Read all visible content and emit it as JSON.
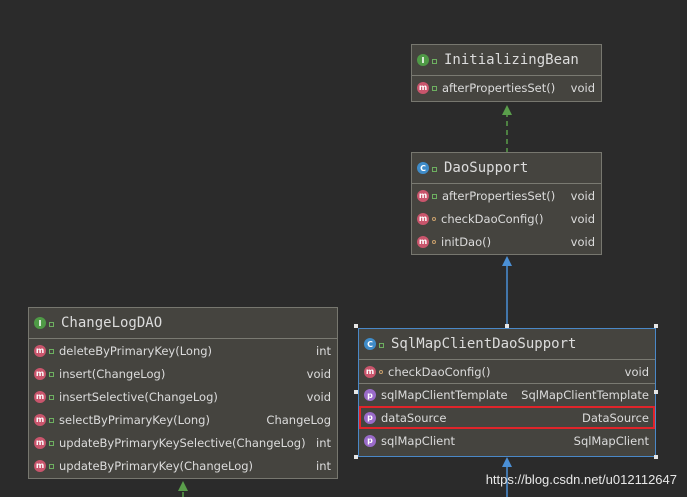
{
  "classes": {
    "initializing_bean": {
      "title": "InitializingBean",
      "kind_icon": "I",
      "rows": [
        {
          "icon": "m",
          "name": "afterPropertiesSet()",
          "type": "void"
        }
      ]
    },
    "dao_support": {
      "title": "DaoSupport",
      "kind_icon": "C",
      "rows": [
        {
          "icon": "m",
          "name": "afterPropertiesSet()",
          "type": "void"
        },
        {
          "icon": "m",
          "name": "checkDaoConfig()",
          "type": "void"
        },
        {
          "icon": "m",
          "name": "initDao()",
          "type": "void"
        }
      ]
    },
    "change_log_dao": {
      "title": "ChangeLogDAO",
      "kind_icon": "I",
      "rows": [
        {
          "icon": "m",
          "name": "deleteByPrimaryKey(Long)",
          "type": "int"
        },
        {
          "icon": "m",
          "name": "insert(ChangeLog)",
          "type": "void"
        },
        {
          "icon": "m",
          "name": "insertSelective(ChangeLog)",
          "type": "void"
        },
        {
          "icon": "m",
          "name": "selectByPrimaryKey(Long)",
          "type": "ChangeLog"
        },
        {
          "icon": "m",
          "name": "updateByPrimaryKeySelective(ChangeLog)",
          "type": "int"
        },
        {
          "icon": "m",
          "name": "updateByPrimaryKey(ChangeLog)",
          "type": "int"
        }
      ]
    },
    "sql_map_client_dao_support": {
      "title": "SqlMapClientDaoSupport",
      "kind_icon": "C",
      "methods": [
        {
          "icon": "m",
          "name": "checkDaoConfig()",
          "type": "void"
        }
      ],
      "properties": [
        {
          "icon": "p",
          "name": "sqlMapClientTemplate",
          "type": "SqlMapClientTemplate"
        },
        {
          "icon": "p",
          "name": "dataSource",
          "type": "DataSource"
        },
        {
          "icon": "p",
          "name": "sqlMapClient",
          "type": "SqlMapClient"
        }
      ]
    }
  },
  "watermark": "https://blog.csdn.net/u012112647",
  "colors": {
    "background": "#2b2b2b",
    "box": "#45443f",
    "implements_arrow": "#5a9e4b",
    "extends_arrow": "#4b90d6",
    "highlight": "#e0242a"
  }
}
